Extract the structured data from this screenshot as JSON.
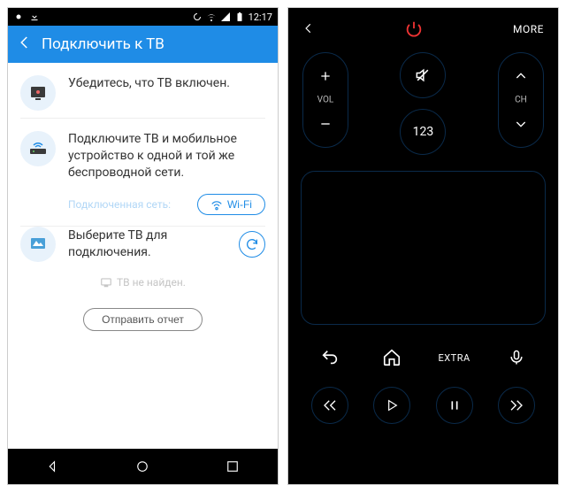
{
  "left": {
    "status": {
      "time": "12:17"
    },
    "appbar": {
      "title": "Подключить к ТВ"
    },
    "step1": {
      "text": "Убедитесь, что ТВ включен."
    },
    "step2": {
      "text": "Подключите ТВ и мобильное устройство к одной и той же беспроводной сети."
    },
    "network_label": "Подключенная сеть:",
    "wifi_button": "Wi-Fi",
    "step3": {
      "text": "Выберите ТВ для подключения."
    },
    "not_found": "ТВ не найден.",
    "send_report": "Отправить отчет"
  },
  "right": {
    "more": "MORE",
    "vol_label": "VOL",
    "ch_label": "CH",
    "numpad_label": "123",
    "extra_label": "EXTRA"
  }
}
